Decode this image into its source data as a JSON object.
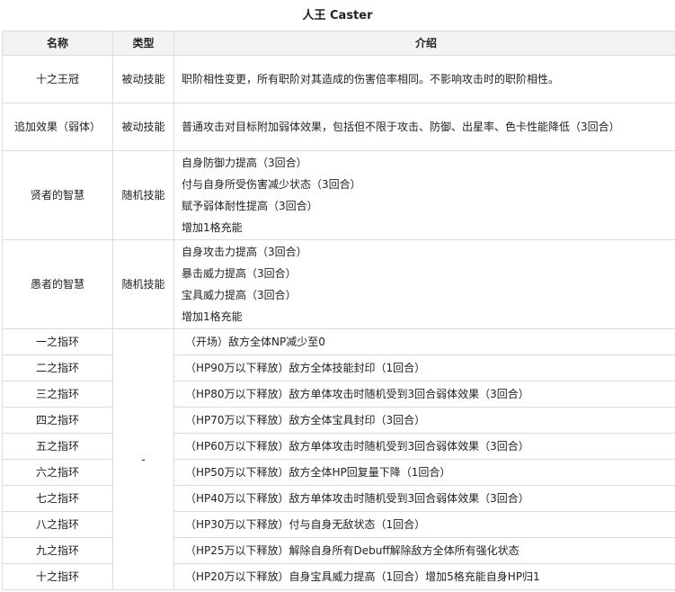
{
  "title": "人王 Caster",
  "headers": {
    "name": "名称",
    "type": "类型",
    "desc": "介绍"
  },
  "skills": [
    {
      "name": "十之王冠",
      "type": "被动技能",
      "desc": [
        "职阶相性变更，所有职阶对其造成的伤害倍率相同。不影响攻击时的职阶相性。"
      ]
    },
    {
      "name": "追加效果（弱体）",
      "type": "被动技能",
      "desc": [
        "普通攻击对目标附加弱体效果，包括但不限于攻击、防御、出星率、色卡性能降低（3回合）"
      ]
    },
    {
      "name": "贤者的智慧",
      "type": "随机技能",
      "desc": [
        "自身防御力提高（3回合）",
        "付与自身所受伤害减少状态（3回合）",
        "赋予弱体耐性提高（3回合）",
        "增加1格充能"
      ]
    },
    {
      "name": "愚者的智慧",
      "type": "随机技能",
      "desc": [
        "自身攻击力提高（3回合）",
        "暴击威力提高（3回合）",
        "宝具威力提高（3回合）",
        "增加1格充能"
      ]
    }
  ],
  "rings_type": "-",
  "rings": [
    {
      "name": "一之指环",
      "desc": "（开场）敌方全体NP减少至0"
    },
    {
      "name": "二之指环",
      "desc": "（HP90万以下释放）敌方全体技能封印（1回合）"
    },
    {
      "name": "三之指环",
      "desc": "（HP80万以下释放）敌方单体攻击时随机受到3回合弱体效果（3回合）"
    },
    {
      "name": "四之指环",
      "desc": "（HP70万以下释放）敌方全体宝具封印（3回合）"
    },
    {
      "name": "五之指环",
      "desc": "（HP60万以下释放）敌方单体攻击时随机受到3回合弱体效果（3回合）"
    },
    {
      "name": "六之指环",
      "desc": "（HP50万以下释放）敌方全体HP回复量下降（1回合）"
    },
    {
      "name": "七之指环",
      "desc": "（HP40万以下释放）敌方单体攻击时随机受到3回合弱体效果（3回合）"
    },
    {
      "name": "八之指环",
      "desc": "（HP30万以下释放）付与自身无敌状态（1回合）"
    },
    {
      "name": "九之指环",
      "desc": "（HP25万以下释放）解除自身所有Debuff解除敌方全体所有强化状态"
    },
    {
      "name": "十之指环",
      "desc": "（HP20万以下释放）自身宝具威力提高（1回合）增加5格充能自身HP归1"
    }
  ]
}
